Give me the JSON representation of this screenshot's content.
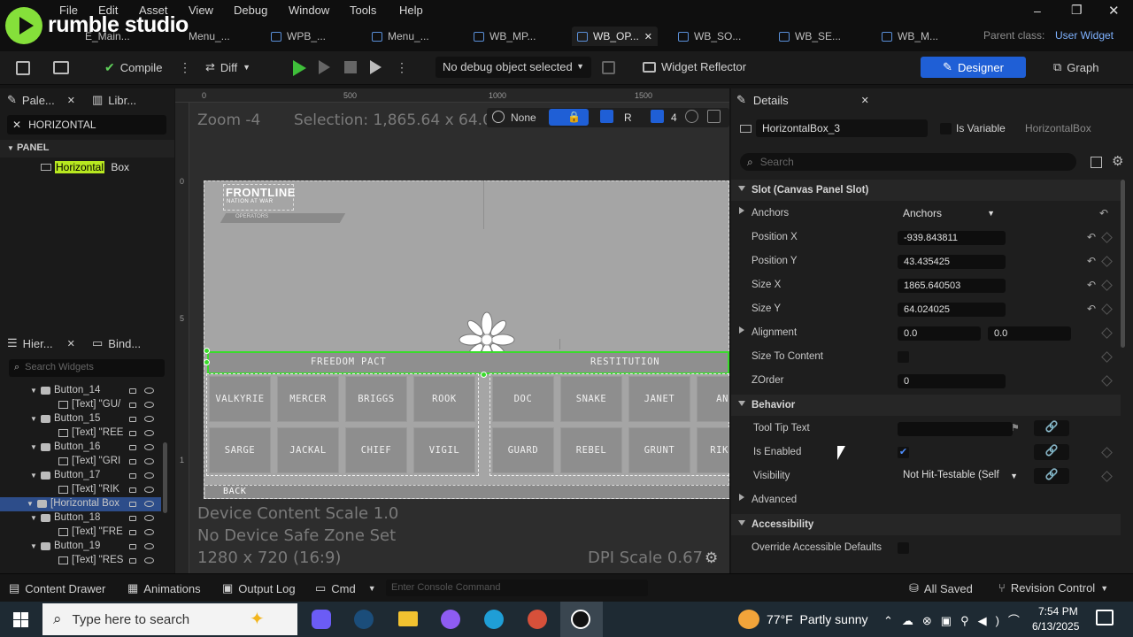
{
  "app": {
    "logo_text": "rumble studio",
    "menu": [
      "File",
      "Edit",
      "Asset",
      "View",
      "Debug",
      "Window",
      "Tools",
      "Help"
    ],
    "window_controls": [
      "–",
      "❐",
      "✕"
    ]
  },
  "tabs": [
    {
      "label": "E_Main..."
    },
    {
      "label": "Menu_..."
    },
    {
      "label": "WPB_..."
    },
    {
      "label": "Menu_..."
    },
    {
      "label": "WB_MP..."
    },
    {
      "label": "WB_OP...",
      "active": true,
      "close": "✕"
    },
    {
      "label": "WB_SO..."
    },
    {
      "label": "WB_SE..."
    },
    {
      "label": "WB_M..."
    }
  ],
  "parent_class": {
    "label": "Parent class:",
    "value": "User Widget"
  },
  "toolbar": {
    "compile": "Compile",
    "diff": "Diff",
    "debug_object": "No debug object selected",
    "widget_reflector": "Widget Reflector",
    "designer": "Designer",
    "graph": "Graph"
  },
  "palette": {
    "tab1": "Pale...",
    "tab2": "Libr...",
    "search_value": "HORIZONTAL",
    "category": "PANEL",
    "result_highlight": "Horizontal",
    "result_rest": " Box"
  },
  "hierarchy": {
    "tab1": "Hier...",
    "tab2": "Bind...",
    "search_placeholder": "Search Widgets",
    "items": [
      {
        "label": "Button_14",
        "indent": 1
      },
      {
        "label": "[Text] \"GU/",
        "indent": 2
      },
      {
        "label": "Button_15",
        "indent": 1
      },
      {
        "label": "[Text] \"REE",
        "indent": 2
      },
      {
        "label": "Button_16",
        "indent": 1
      },
      {
        "label": "[Text] \"GRI",
        "indent": 2
      },
      {
        "label": "Button_17",
        "indent": 1
      },
      {
        "label": "[Text] \"RIK",
        "indent": 2
      },
      {
        "label": "[Horizontal Box",
        "indent": 0,
        "selected": true
      },
      {
        "label": "Button_18",
        "indent": 1
      },
      {
        "label": "[Text] \"FRE",
        "indent": 2
      },
      {
        "label": "Button_19",
        "indent": 1
      },
      {
        "label": "[Text] \"RES",
        "indent": 2
      }
    ]
  },
  "viewport": {
    "zoom": "Zoom -4",
    "selection": "Selection: 1,865.64 x 64.02",
    "none_label": "None",
    "r_label": "R",
    "grid_num": "4",
    "ruler": [
      "0",
      "500",
      "1000",
      "1500"
    ],
    "left_ruler": [
      "0",
      "5",
      "0",
      "0",
      "1",
      "0",
      "0",
      "0"
    ],
    "device_scale": "Device Content Scale 1.0",
    "safe_zone": "No Device Safe Zone Set",
    "resolution": "1280 x 720 (16:9)",
    "dpi": "DPI Scale 0.67",
    "logo_title": "FRONTLINE",
    "logo_sub": "NATION AT WAR",
    "logo_small": "OPERATORS",
    "faction_left": "FREEDOM PACT",
    "faction_right": "RESTITUTION",
    "row1": [
      "VALKYRIE",
      "MERCER",
      "BRIGGS",
      "ROOK",
      "DOC",
      "SNAKE",
      "JANET",
      "AN"
    ],
    "row2": [
      "SARGE",
      "JACKAL",
      "CHIEF",
      "VIGIL",
      "GUARD",
      "REBEL",
      "GRUNT",
      "RIK"
    ],
    "back": "BACK"
  },
  "details": {
    "title": "Details",
    "widget_name": "HorizontalBox_3",
    "is_variable": "Is Variable",
    "class_name": "HorizontalBox",
    "search_placeholder": "Search",
    "slot_section": "Slot (Canvas Panel Slot)",
    "anchors": {
      "label": "Anchors",
      "value": "Anchors"
    },
    "position_x": {
      "label": "Position X",
      "value": "-939.843811"
    },
    "position_y": {
      "label": "Position Y",
      "value": "43.435425"
    },
    "size_x": {
      "label": "Size X",
      "value": "1865.640503"
    },
    "size_y": {
      "label": "Size Y",
      "value": "64.024025"
    },
    "alignment": {
      "label": "Alignment",
      "x": "0.0",
      "y": "0.0"
    },
    "size_to_content": {
      "label": "Size To Content"
    },
    "zorder": {
      "label": "ZOrder",
      "value": "0"
    },
    "behavior_section": "Behavior",
    "tooltip": {
      "label": "Tool Tip Text"
    },
    "is_enabled": {
      "label": "Is Enabled",
      "checked": true
    },
    "visibility": {
      "label": "Visibility",
      "value": "Not Hit-Testable (Self"
    },
    "advanced": "Advanced",
    "accessibility_section": "Accessibility",
    "override_accessible": {
      "label": "Override Accessible Defaults"
    }
  },
  "statusbar": {
    "content_drawer": "Content Drawer",
    "animations": "Animations",
    "output_log": "Output Log",
    "cmd": "Cmd",
    "console_placeholder": "Enter Console Command",
    "all_saved": "All Saved",
    "revision": "Revision Control"
  },
  "taskbar": {
    "search_placeholder": "Type here to search",
    "weather": "77°F  Partly sunny",
    "time": "7:54 PM",
    "date": "6/13/2025"
  },
  "colors": {
    "accent": "#1f5fd6",
    "green": "#3adb2c",
    "highlight": "#b8e820",
    "brand_green": "#85e03a"
  }
}
